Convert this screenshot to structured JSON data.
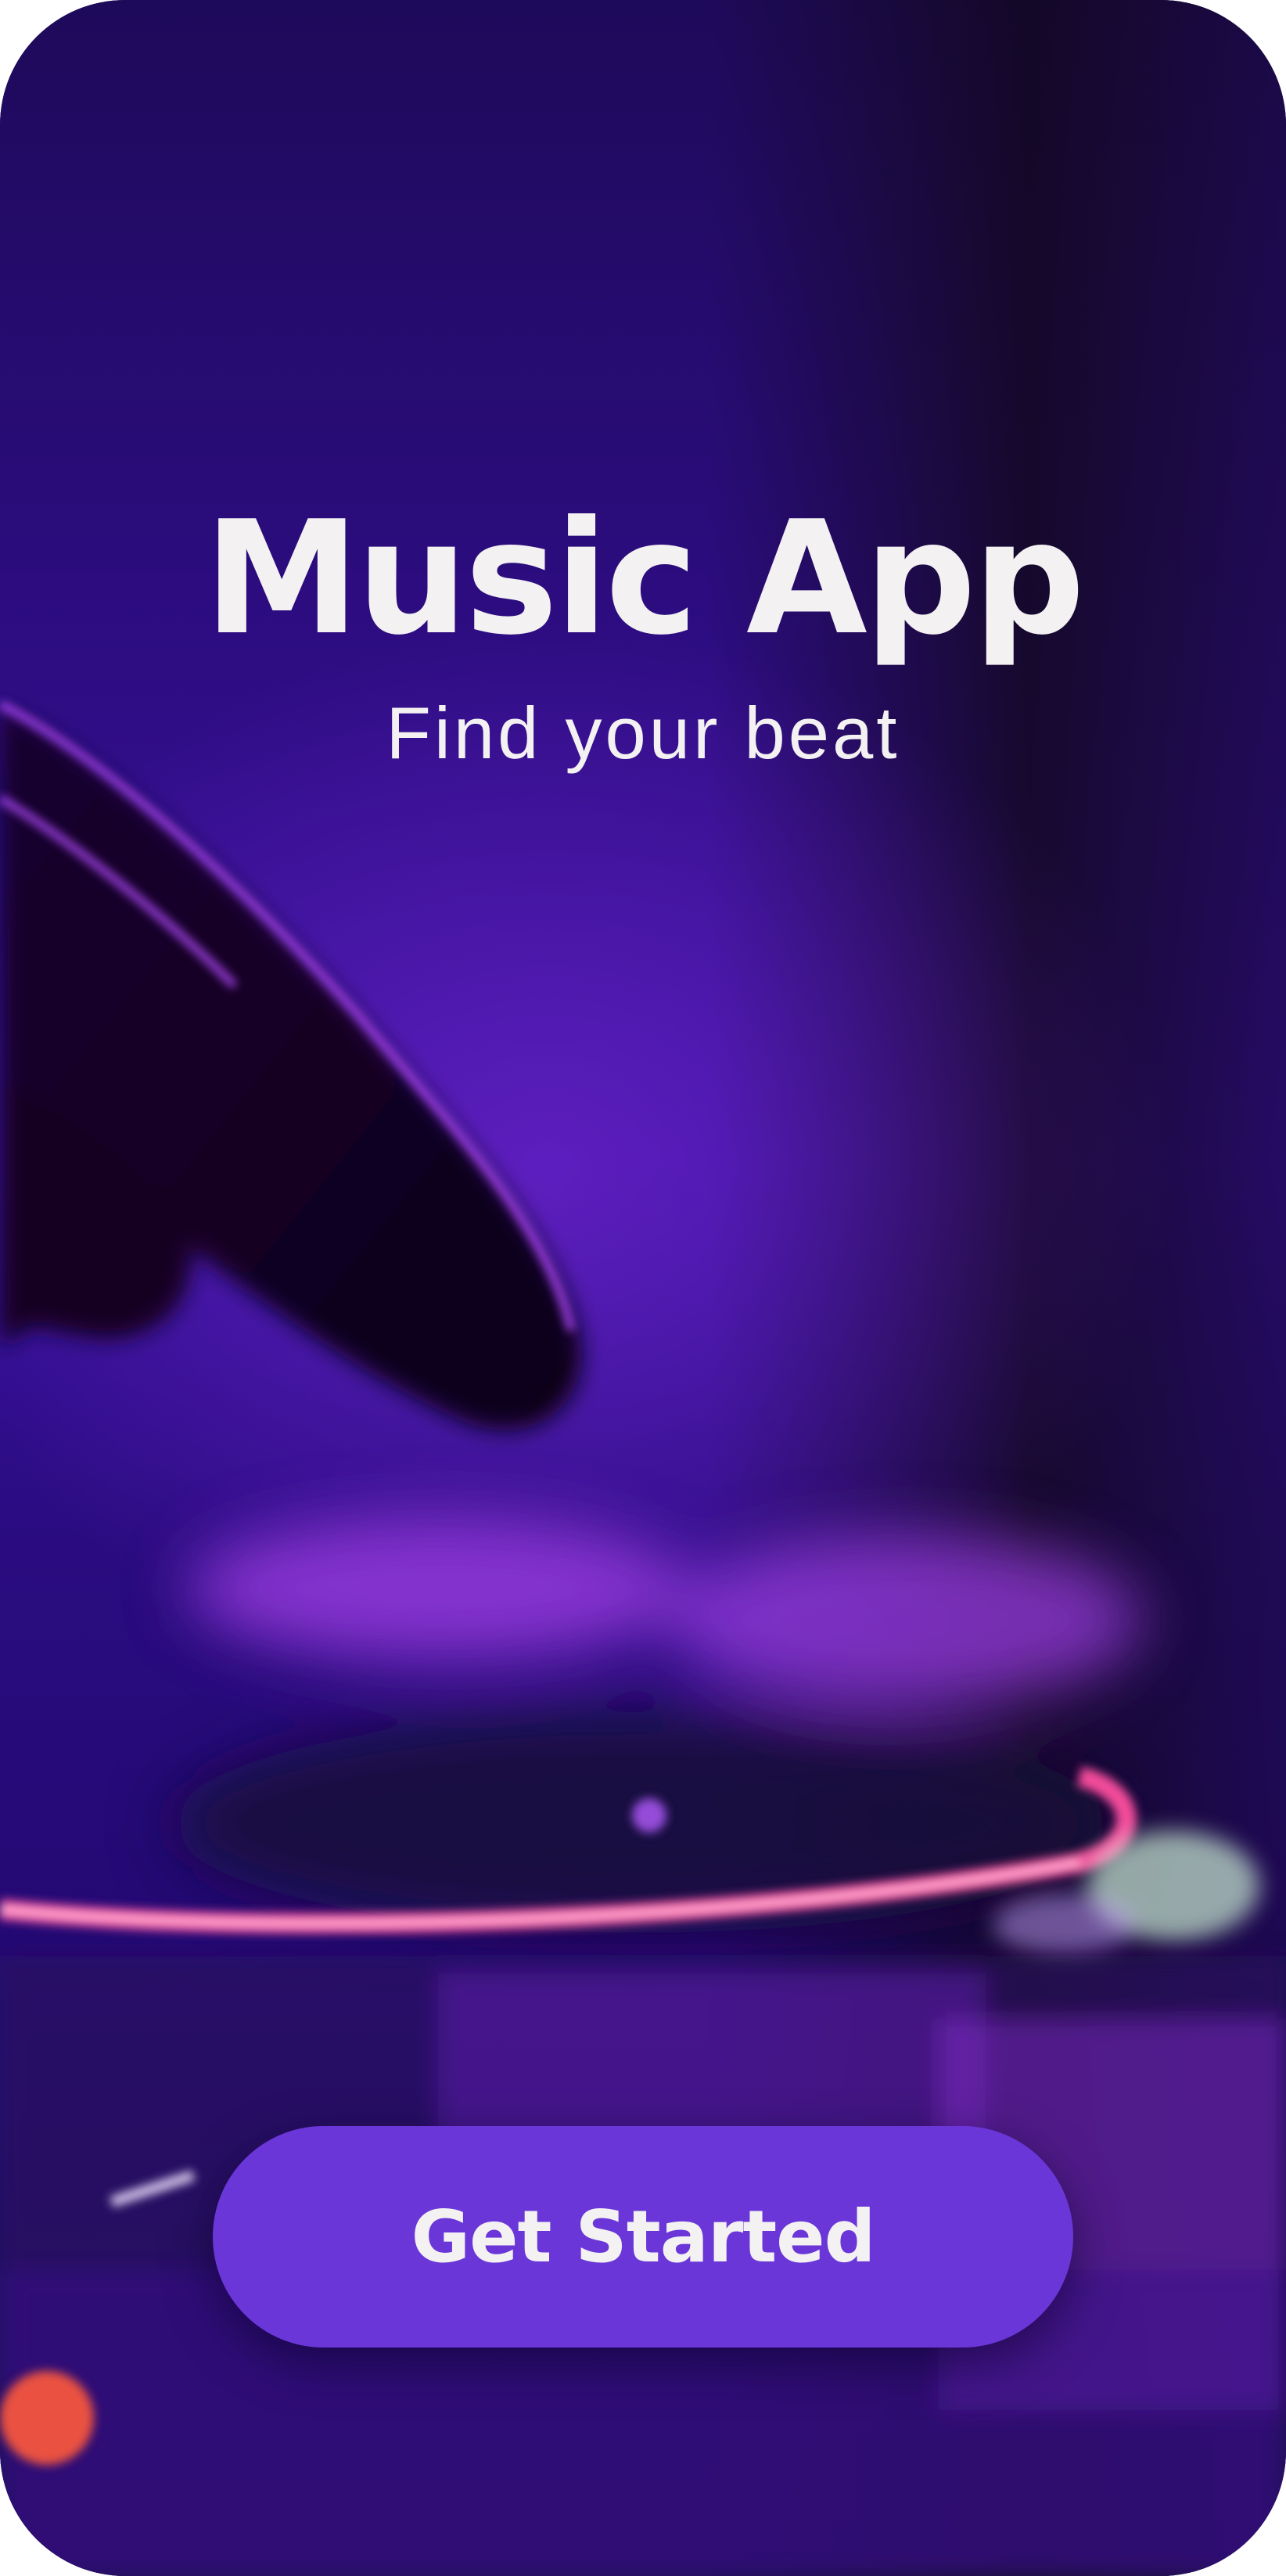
{
  "app": {
    "title": "Music App",
    "subtitle": "Find your beat"
  },
  "actions": {
    "get_started_label": "Get Started"
  },
  "colors": {
    "background_primary": "#2a0c7a",
    "button_background": "#6a36d8",
    "text": "#f3f1f2",
    "neon_ring": "#ff4fa0"
  },
  "background_image": "dj-turntable-photo"
}
